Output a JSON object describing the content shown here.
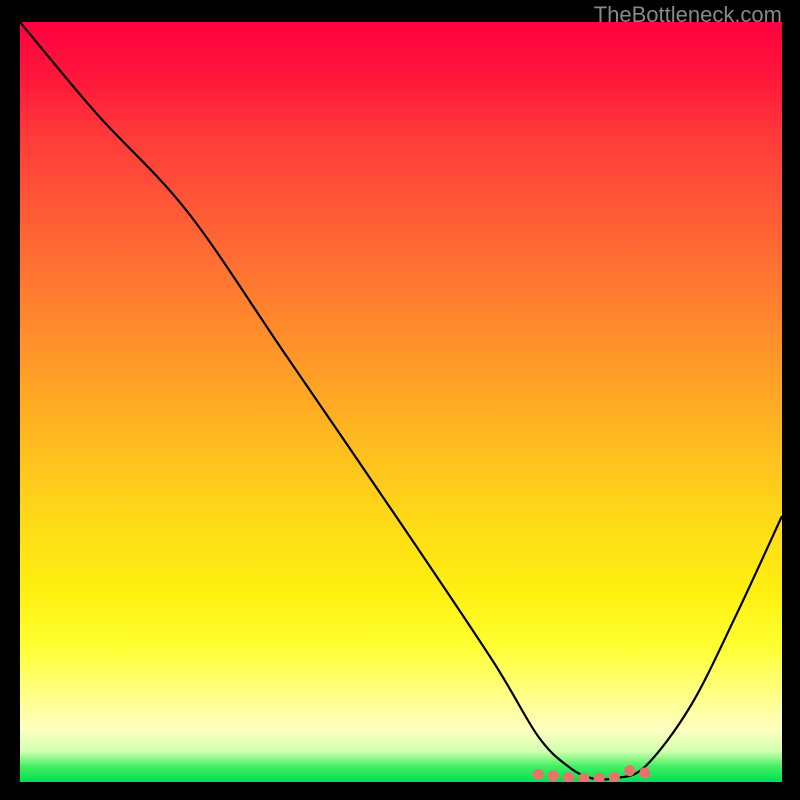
{
  "watermark": "TheBottleneck.com",
  "chart_data": {
    "type": "line",
    "title": "",
    "xlabel": "",
    "ylabel": "",
    "xlim": [
      0,
      100
    ],
    "ylim": [
      0,
      100
    ],
    "gradient": {
      "top_color": "#ff0040",
      "bottom_color": "#00e050",
      "meaning": "bottleneck severity (red=high, green=low)"
    },
    "series": [
      {
        "name": "bottleneck-curve",
        "x": [
          0,
          10,
          22,
          35,
          50,
          62,
          68,
          72,
          75,
          78,
          82,
          88,
          94,
          100
        ],
        "y": [
          100,
          88,
          75,
          56,
          34,
          16,
          6,
          2,
          0.5,
          0.5,
          2,
          10,
          22,
          35
        ]
      }
    ],
    "markers": {
      "name": "optimal-range",
      "x": [
        68,
        70,
        72,
        74,
        76,
        78,
        80,
        82
      ],
      "y": [
        1.0,
        0.8,
        0.6,
        0.5,
        0.5,
        0.6,
        1.5,
        1.2
      ],
      "color": "#e8736a"
    }
  }
}
